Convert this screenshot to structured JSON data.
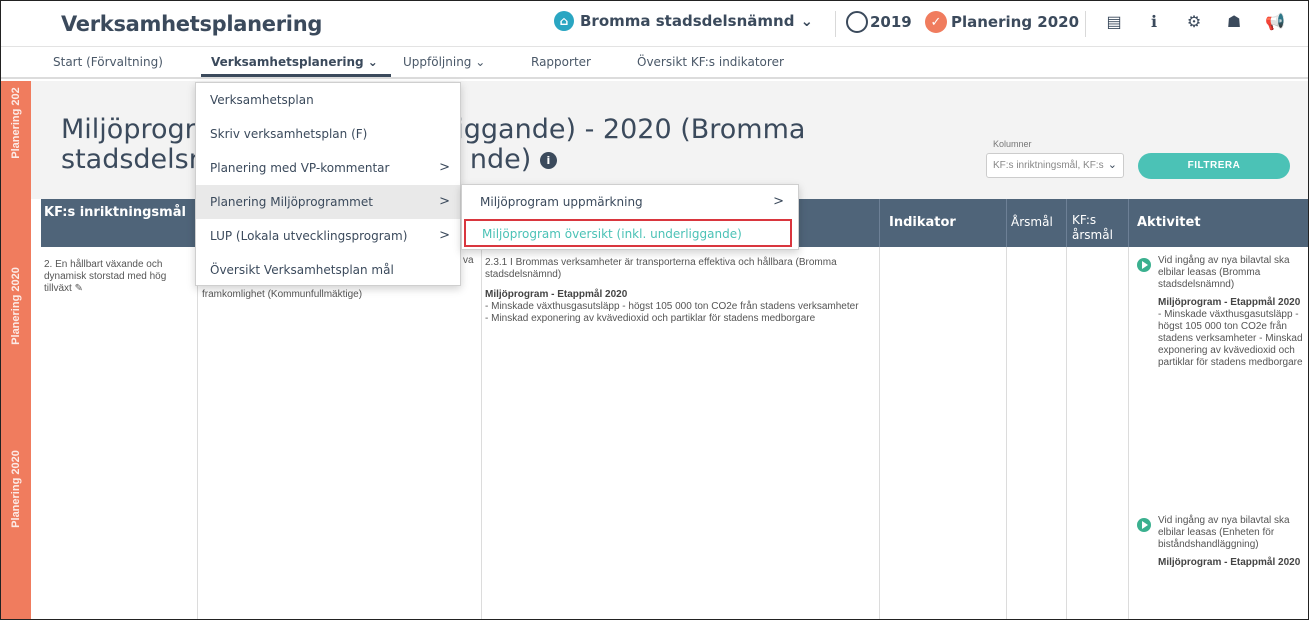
{
  "header": {
    "app_title": "Verksamhetsplanering",
    "org_name": "Bromma stadsdelsnämnd",
    "org_chevron": "⌄",
    "year_2019": "2019",
    "plan_label": "Planering 2020",
    "icons": [
      "print-icon",
      "info-icon",
      "settings-icon",
      "user-icon",
      "megaphone-icon"
    ]
  },
  "nav": {
    "items": [
      {
        "label": "Start (Förvaltning)"
      },
      {
        "label": "Verksamhetsplanering ⌄"
      },
      {
        "label": "Uppföljning ⌄"
      },
      {
        "label": "Rapporter"
      },
      {
        "label": "Översikt KF:s indikatorer"
      }
    ]
  },
  "sidebar": {
    "labels": [
      "Planering 202",
      "Planering 2020",
      "Planering 2020",
      "Planering 2020"
    ]
  },
  "page": {
    "title_line1": "Miljöprogra",
    "title_line1b": "iggande) - 2020 (Bromma",
    "title_line2": "stadsdelsn",
    "title_line2b": "nde)",
    "info": "i"
  },
  "columns_filter": {
    "label": "Kolumner",
    "value": "KF:s inriktningsmål, KF:s",
    "button": "FILTRERA"
  },
  "table": {
    "headers": {
      "kf_mal": "KF:s inriktningsmål",
      "indikator": "Indikator",
      "arsmal": "Årsmål",
      "kf_arsmal": "KF:s årsmål",
      "aktivitet": "Aktivitet"
    },
    "row": {
      "kf_mal": "2. En hållbart växande och dynamisk storstad med hög tillväxt",
      "col2_prefix": "va",
      "col2_text": "framkomlighet (Kommunfullmäktige)",
      "col3_text": "2.3.1 I Brommas verksamheter är transporterna effektiva och hållbara (Bromma stadsdelsnämnd)",
      "col3_goal_title": "Miljöprogram - Etappmål 2020",
      "col3_goal_1": "- Minskade växthusgasutsläpp - högst 105 000 ton CO2e från stadens verksamheter",
      "col3_goal_2": "- Minskad exponering av kvävedioxid och partiklar för stadens medborgare"
    },
    "activities": [
      {
        "text": "Vid ingång av nya bilavtal ska elbilar leasas (Bromma stadsdelsnämnd)",
        "goal_title": "Miljöprogram - Etappmål 2020",
        "goal_text": "- Minskade växthusgasutsläpp - högst 105 000 ton CO2e från stadens verksamheter - Minskad exponering av kvävedioxid och partiklar för stadens medborgare"
      },
      {
        "text": "Vid ingång av nya bilavtal ska elbilar leasas (Enheten för biståndshandläggning)",
        "goal_title": "Miljöprogram - Etappmål 2020"
      }
    ]
  },
  "menu": {
    "items": [
      {
        "label": "Verksamhetsplan",
        "arrow": ""
      },
      {
        "label": "Skriv verksamhetsplan (F)",
        "arrow": ""
      },
      {
        "label": "Planering med VP-kommentar",
        "arrow": ">"
      },
      {
        "label": "Planering Miljöprogrammet",
        "arrow": ">"
      },
      {
        "label": "LUP (Lokala utvecklingsprogram)",
        "arrow": ">"
      },
      {
        "label": "Översikt Verksamhetsplan mål",
        "arrow": ""
      }
    ]
  },
  "submenu": {
    "items": [
      {
        "label": "Miljöprogram uppmärkning",
        "arrow": ">"
      },
      {
        "label": "Miljöprogram översikt (inkl. underliggande)",
        "arrow": ""
      }
    ]
  },
  "colors": {
    "accent": "#4bc2b6",
    "strip": "#f07c5e",
    "header_bg": "#4f6479",
    "highlight_border": "#d9363e"
  }
}
